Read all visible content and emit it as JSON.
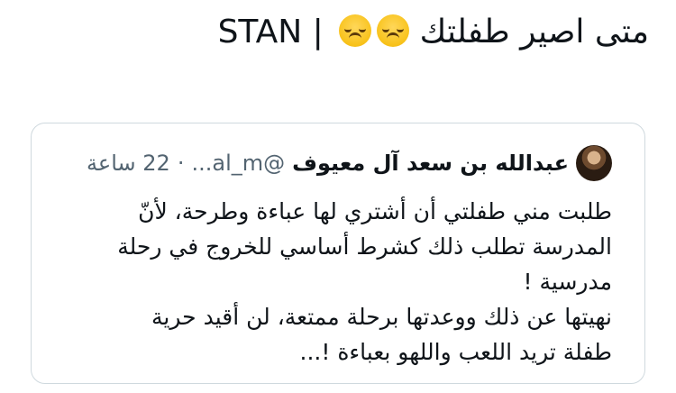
{
  "tweet": {
    "text": "متى اصير طفلتك",
    "separator": "|",
    "suffix": "STAN",
    "emojis": [
      "disappointed-face",
      "disappointed-face"
    ]
  },
  "quoted_tweet": {
    "time": "22 ساعة",
    "dot": "·",
    "handle": "@al_m...",
    "name": "عبدالله بن سعد آل معيوف",
    "lines": [
      "طلبت مني طفلتي أن أشتري لها عباءة وطرحة، لأنّ",
      "المدرسة تطلب ذلك كشرط أساسي للخروج في رحلة",
      "مدرسية !",
      "نهيتها عن ذلك ووعدتها برحلة ممتعة، لن أقيد حرية",
      "طفلة تريد اللعب واللهو بعباءة !..."
    ]
  },
  "colors": {
    "text": "#0f1419",
    "muted": "#536471",
    "border": "#cfd9de"
  }
}
